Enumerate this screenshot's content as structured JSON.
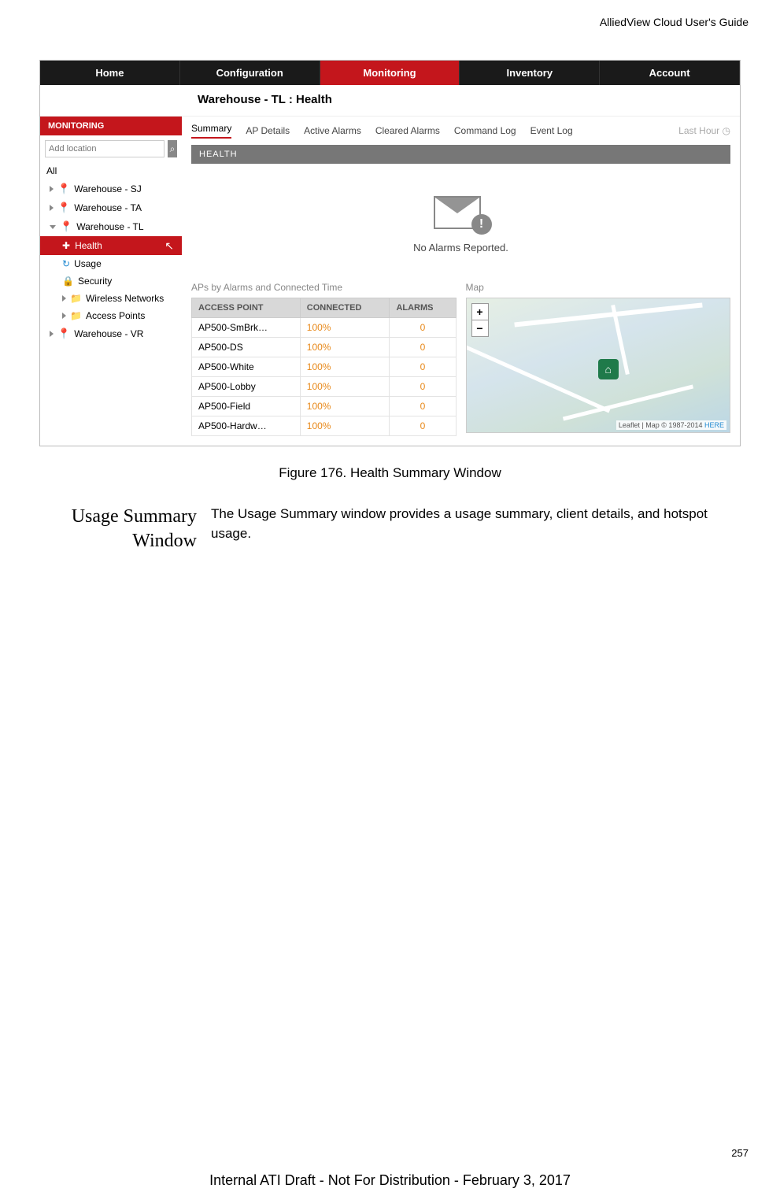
{
  "header_guide": "AlliedView Cloud User's Guide",
  "topnav": {
    "home": "Home",
    "config": "Configuration",
    "monitoring": "Monitoring",
    "inventory": "Inventory",
    "account": "Account"
  },
  "breadcrumb": "Warehouse - TL :  Health",
  "sidebar_title": "MONITORING",
  "search_placeholder": "Add location",
  "tree": {
    "all": "All",
    "sj": "Warehouse - SJ",
    "ta": "Warehouse - TA",
    "tl": "Warehouse - TL",
    "health": "Health",
    "usage": "Usage",
    "security": "Security",
    "wireless": "Wireless Networks",
    "aps": "Access Points",
    "vr": "Warehouse - VR"
  },
  "subtabs": {
    "summary": "Summary",
    "apdetails": "AP Details",
    "active": "Active Alarms",
    "cleared": "Cleared Alarms",
    "cmdlog": "Command Log",
    "eventlog": "Event Log",
    "lasthour": "Last Hour"
  },
  "health_bar": "HEALTH",
  "no_alarms": "No Alarms Reported.",
  "aps_title": "APs by Alarms and Connected Time",
  "map_title": "Map",
  "ap_headers": {
    "ap": "ACCESS POINT",
    "conn": "CONNECTED",
    "al": "ALARMS"
  },
  "ap_rows": [
    {
      "name": "AP500-SmBrk…",
      "conn": "100%",
      "al": "0"
    },
    {
      "name": "AP500-DS",
      "conn": "100%",
      "al": "0"
    },
    {
      "name": "AP500-White",
      "conn": "100%",
      "al": "0"
    },
    {
      "name": "AP500-Lobby",
      "conn": "100%",
      "al": "0"
    },
    {
      "name": "AP500-Field",
      "conn": "100%",
      "al": "0"
    },
    {
      "name": "AP500-Hardw…",
      "conn": "100%",
      "al": "0"
    }
  ],
  "map_attr_prefix": "Leaflet",
  "map_attr_mid": " | Map © 1987-2014 ",
  "map_attr_link": "HERE",
  "zoom_in": "+",
  "zoom_out": "−",
  "figure_caption": "Figure 176. Health Summary Window",
  "section_title": "Usage Summary Window",
  "section_body": "The Usage Summary window provides a usage summary, client details, and hotspot usage.",
  "page_number": "257",
  "footer": "Internal ATI Draft - Not For Distribution - February 3, 2017"
}
